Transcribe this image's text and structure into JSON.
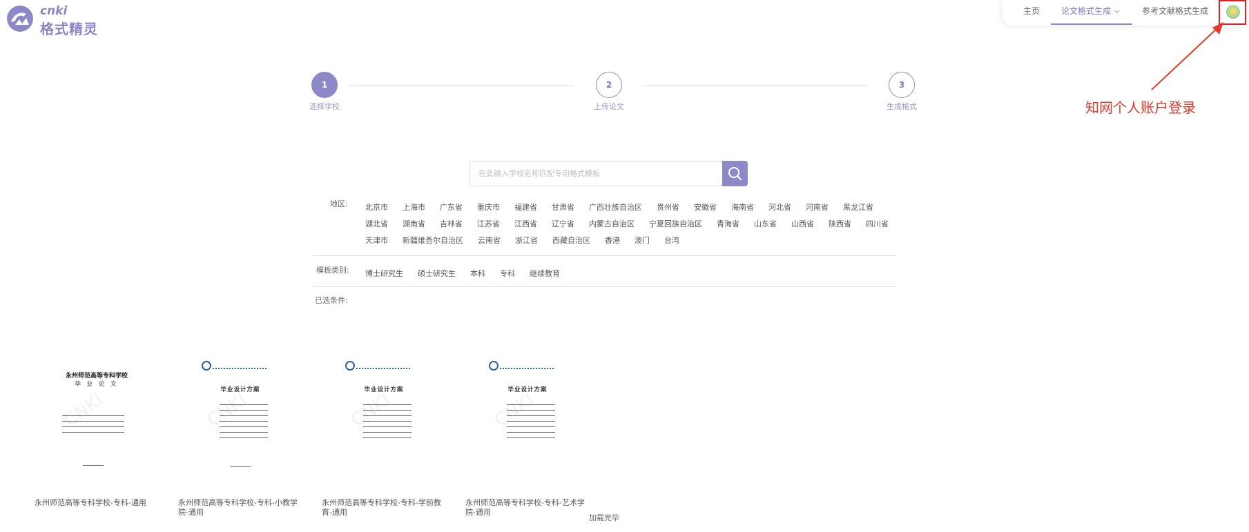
{
  "logo": {
    "cnki": "cnki",
    "brand": "格式精灵"
  },
  "nav": {
    "home": "主页",
    "paper_format": "论文格式生成",
    "ref_format": "参考文献格式生成"
  },
  "annotation": {
    "text": "知网个人账户登录",
    "color": "#e03a2a"
  },
  "steps": [
    {
      "num": "1",
      "label": "选择学校"
    },
    {
      "num": "2",
      "label": "上传论文"
    },
    {
      "num": "3",
      "label": "生成格式"
    }
  ],
  "search": {
    "placeholder": "在此输入学校名称匹配专用格式模板"
  },
  "filters": {
    "region_label": "地区:",
    "regions_row1": [
      "北京市",
      "上海市",
      "广东省",
      "重庆市",
      "福建省",
      "甘肃省",
      "广西壮族自治区",
      "贵州省",
      "安徽省",
      "海南省",
      "河北省",
      "河南省",
      "黑龙江省"
    ],
    "regions_row2": [
      "湖北省",
      "湖南省",
      "吉林省",
      "江苏省",
      "江西省",
      "辽宁省",
      "内蒙古自治区",
      "宁夏回族自治区",
      "青海省",
      "山东省",
      "山西省",
      "陕西省",
      "四川省"
    ],
    "regions_row3": [
      "天津市",
      "新疆维吾尔自治区",
      "云南省",
      "浙江省",
      "西藏自治区",
      "香港",
      "澳门",
      "台湾"
    ],
    "category_label": "模板类别:",
    "categories": [
      "博士研究生",
      "硕士研究生",
      "本科",
      "专科",
      "继续教育"
    ],
    "selected_label": "已选条件:"
  },
  "templates": [
    {
      "caption": "永州师范高等专科学校-专科-通用",
      "thumb_title": "永州师范高等专科学校",
      "thumb_subtitle": "毕 业 论 文"
    },
    {
      "caption": "永州师范高等专科学校-专科-小教学院-通用",
      "thumb_title": "",
      "thumb_subtitle": "毕业设计方案"
    },
    {
      "caption": "永州师范高等专科学校-专科-学前教育-通用",
      "thumb_title": "",
      "thumb_subtitle": "毕业设计方案"
    },
    {
      "caption": "永州师范高等专科学校-专科-艺术学院-通用",
      "thumb_title": "",
      "thumb_subtitle": "毕业设计方案"
    }
  ],
  "load_status": "加载完毕",
  "colors": {
    "accent": "#8d89c8",
    "highlight": "#e02020"
  }
}
